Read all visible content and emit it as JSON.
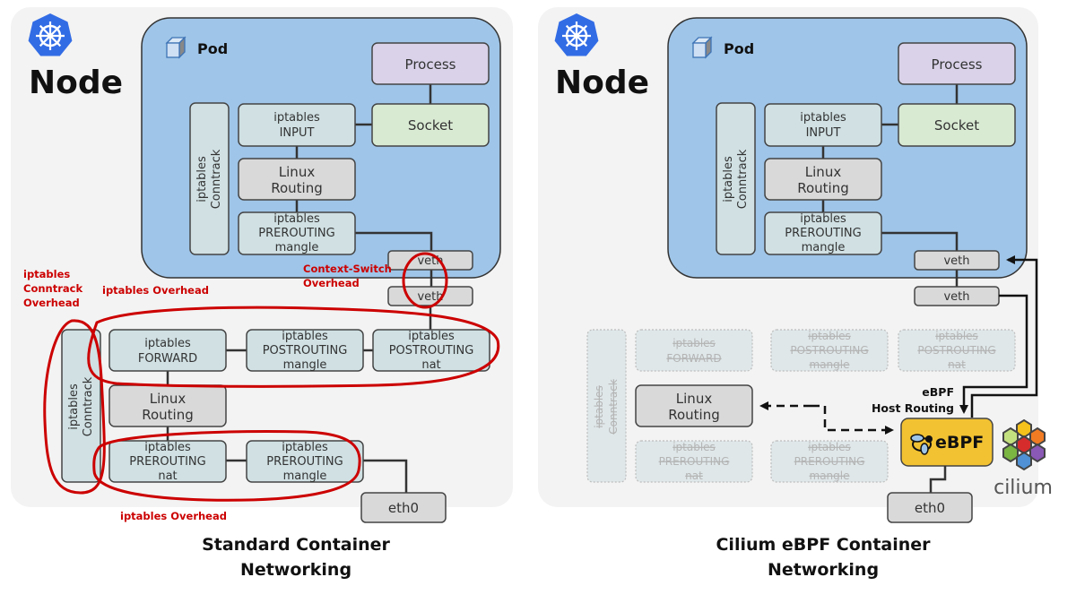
{
  "left": {
    "node_title": "Node",
    "pod_title": "Pod",
    "process": "Process",
    "socket": "Socket",
    "pod_ipt_input": [
      "iptables",
      "INPUT"
    ],
    "pod_linux_routing": [
      "Linux",
      "Routing"
    ],
    "pod_ipt_prerouting_mangle": [
      "iptables",
      "PREROUTING",
      "mangle"
    ],
    "pod_conntrack": [
      "iptables",
      "Conntrack"
    ],
    "veth_pod": "veth",
    "veth_host": "veth",
    "ipt_forward": [
      "iptables",
      "FORWARD"
    ],
    "ipt_postrouting_mangle": [
      "iptables",
      "POSTROUTING",
      "mangle"
    ],
    "ipt_postrouting_nat": [
      "iptables",
      "POSTROUTING",
      "nat"
    ],
    "host_linux_routing": [
      "Linux",
      "Routing"
    ],
    "ipt_prerouting_nat": [
      "iptables",
      "PREROUTING",
      "nat"
    ],
    "ipt_prerouting_mangle": [
      "iptables",
      "PREROUTING",
      "mangle"
    ],
    "host_conntrack": [
      "iptables",
      "Conntrack"
    ],
    "eth0": "eth0",
    "annotations": {
      "conntrack_overhead": [
        "iptables",
        "Conntrack",
        "Overhead"
      ],
      "iptables_overhead_top": "iptables Overhead",
      "context_switch_overhead": [
        "Context-Switch",
        "Overhead"
      ],
      "iptables_overhead_bottom": "iptables Overhead"
    },
    "caption": [
      "Standard Container",
      "Networking"
    ]
  },
  "right": {
    "node_title": "Node",
    "pod_title": "Pod",
    "process": "Process",
    "socket": "Socket",
    "pod_ipt_input": [
      "iptables",
      "INPUT"
    ],
    "pod_linux_routing": [
      "Linux",
      "Routing"
    ],
    "pod_ipt_prerouting_mangle": [
      "iptables",
      "PREROUTING",
      "mangle"
    ],
    "pod_conntrack": [
      "iptables",
      "Conntrack"
    ],
    "veth_pod": "veth",
    "veth_host": "veth",
    "ghost_forward": [
      "iptables",
      "FORWARD"
    ],
    "ghost_postrouting_mangle": [
      "iptables",
      "POSTROUTING",
      "mangle"
    ],
    "ghost_postrouting_nat": [
      "iptables",
      "POSTROUTING",
      "nat"
    ],
    "ghost_prerouting_nat": [
      "iptables",
      "PREROUTING",
      "nat"
    ],
    "ghost_prerouting_mangle": [
      "iptables",
      "PREROUTING",
      "mangle"
    ],
    "ghost_conntrack": [
      "iptables",
      "Conntrack"
    ],
    "host_linux_routing": [
      "Linux",
      "Routing"
    ],
    "ebpf_host_routing_label": [
      "eBPF",
      "Host Routing"
    ],
    "ebpf_badge": "eBPF",
    "cilium_logo_text": "cilium",
    "eth0": "eth0",
    "caption": [
      "Cilium eBPF Container",
      "Networking"
    ]
  },
  "colors": {
    "pod_bg": "#9fc5e8",
    "iptables_box": "#d0e0e3",
    "routing_box": "#d9d9d9",
    "process_box": "#d9d2e9",
    "socket_box": "#d9ead3",
    "ebpf_box": "#f2c232",
    "overhead_red": "#cc0000",
    "kubernetes_blue": "#326ce5"
  }
}
